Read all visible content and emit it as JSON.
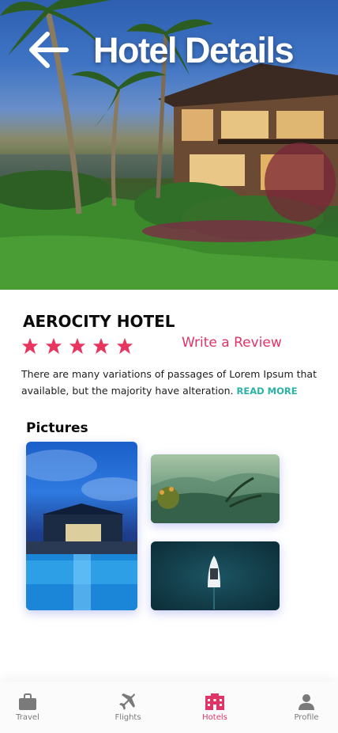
{
  "header": {
    "title": "Hotel Details",
    "back_icon": "arrow-left-icon"
  },
  "hotel": {
    "name": "AEROCITY HOTEL",
    "rating": 5,
    "rating_max": 5,
    "star_color": "#e8345f",
    "review_link": "Write a Review",
    "description": "There are many variations of passages of Lorem Ipsum that available, but the majority have alteration.",
    "read_more": "READ MORE"
  },
  "pictures": {
    "title": "Pictures",
    "items": [
      {
        "subject": "resort pool at night"
      },
      {
        "subject": "misty green mountains"
      },
      {
        "subject": "yacht on dark sea"
      }
    ]
  },
  "nav": {
    "items": [
      {
        "label": "Travel",
        "icon": "briefcase-icon",
        "active": false
      },
      {
        "label": "Flights",
        "icon": "airplane-icon",
        "active": false
      },
      {
        "label": "Hotels",
        "icon": "hotel-icon",
        "active": true
      },
      {
        "label": "Profile",
        "icon": "person-icon",
        "active": false
      }
    ]
  },
  "colors": {
    "accent": "#e03468",
    "link": "#2bb3a5",
    "inactive": "#7a7a7a"
  }
}
